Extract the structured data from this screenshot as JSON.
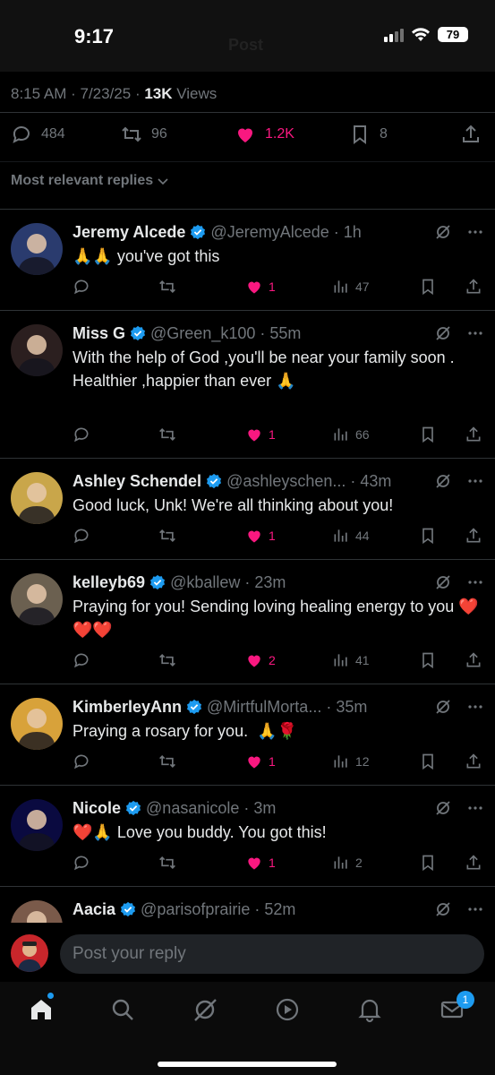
{
  "status_bar": {
    "time": "9:17",
    "battery": "79"
  },
  "header": {
    "ghost_title": "Post"
  },
  "post_meta": {
    "time": "8:15 AM",
    "date": "7/23/25",
    "views_count": "13K",
    "views_label": "Views"
  },
  "post_stats": {
    "replies": "484",
    "reposts": "96",
    "likes": "1.2K",
    "bookmarks": "8"
  },
  "sort": {
    "label": "Most relevant replies"
  },
  "replies": [
    {
      "name": "Jeremy Alcede",
      "handle": "@JeremyAlcede",
      "time": "1h",
      "text": "🙏🙏 you've got this",
      "likes": "1",
      "views": "47",
      "avatar_color": "#2a3b6e"
    },
    {
      "name": "Miss G",
      "handle": "@Green_k100",
      "time": "55m",
      "text": "With the help of God ,you'll be near your family soon .\nHealthier ,happier than ever 🙏",
      "likes": "1",
      "views": "66",
      "avatar_color": "#2b1f1f"
    },
    {
      "name": "Ashley Schendel",
      "handle": "@ashleyschen...",
      "time": "43m",
      "text": "Good luck, Unk! We're all thinking about you!",
      "likes": "1",
      "views": "44",
      "avatar_color": "#c9a64a"
    },
    {
      "name": "kelleyb69",
      "handle": "@kballew",
      "time": "23m",
      "text": "Praying for you! Sending loving healing energy to you ❤️❤️❤️",
      "likes": "2",
      "views": "41",
      "avatar_color": "#6b6050"
    },
    {
      "name": "KimberleyAnn",
      "handle": "@MirtfulMorta...",
      "time": "35m",
      "text": "Praying a rosary for you.  🙏🌹",
      "likes": "1",
      "views": "12",
      "avatar_color": "#d8a23a"
    },
    {
      "name": "Nicole",
      "handle": "@nasanicole",
      "time": "3m",
      "text": "❤️🙏 Love you buddy. You got this!",
      "likes": "1",
      "views": "2",
      "avatar_color": "#0a0a40"
    },
    {
      "name": "Aacia",
      "handle": "@parisofprairie",
      "time": "52m",
      "text": "",
      "likes": "",
      "views": "",
      "avatar_color": "#7a5a4a"
    }
  ],
  "composer": {
    "placeholder": "Post your reply"
  },
  "tabbar": {
    "messages_badge": "1"
  },
  "colors": {
    "like": "#f91880",
    "verified": "#1d9bf0",
    "muted": "#71767b"
  }
}
